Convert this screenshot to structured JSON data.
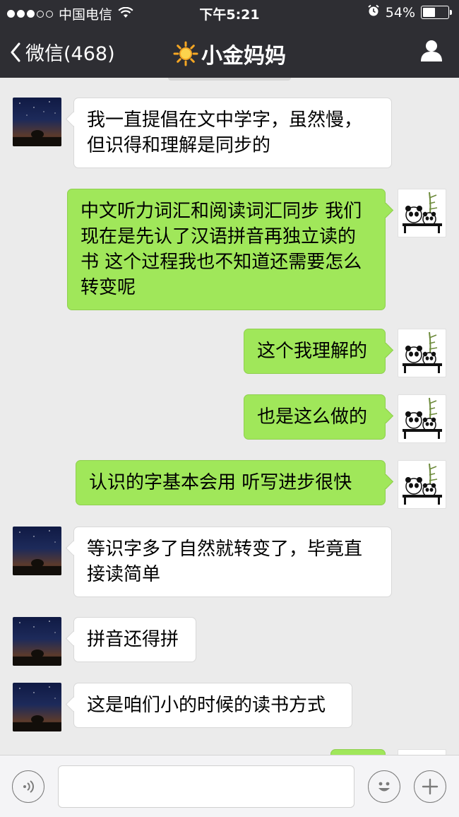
{
  "status_bar": {
    "carrier": "中国电信",
    "time": "下午5:21",
    "battery": "54%",
    "battery_level": 0.54,
    "signal_dots_filled": 3,
    "signal_dots_total": 5
  },
  "nav": {
    "back_label": "微信(468)",
    "title": "小金妈妈",
    "title_icon": "sun-icon",
    "profile_icon": "person-icon"
  },
  "messages": [
    {
      "side": "in",
      "text": "我一直提倡在文中学字，虽然慢，但识得和理解是同步的"
    },
    {
      "side": "out",
      "text": "中文听力词汇和阅读词汇同步 我们现在是先认了汉语拼音再独立读的书 这个过程我也不知道还需要怎么转变呢"
    },
    {
      "side": "out",
      "text": "这个我理解的"
    },
    {
      "side": "out",
      "text": "也是这么做的"
    },
    {
      "side": "out",
      "text": "认识的字基本会用 听写进步很快"
    },
    {
      "side": "in",
      "text": "等识字多了自然就转变了，毕竟直接读简单"
    },
    {
      "side": "in",
      "text": "拼音还得拼"
    },
    {
      "side": "in",
      "text": "这是咱们小的时候的读书方式"
    }
  ],
  "input_bar": {
    "voice_icon": "voice-icon",
    "emoji_icon": "emoji-icon",
    "plus_icon": "plus-icon",
    "text_value": ""
  },
  "colors": {
    "bar_bg": "#2e2e33",
    "chat_bg": "#ebebeb",
    "outgoing_bubble": "#a0e75a",
    "incoming_bubble": "#ffffff"
  }
}
